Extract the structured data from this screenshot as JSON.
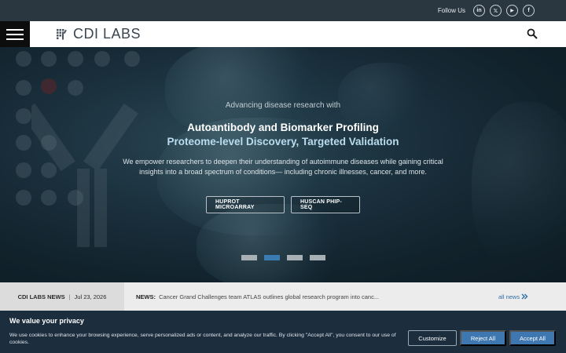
{
  "topbar": {
    "follow_label": "Follow Us",
    "socials": [
      {
        "icon": "linkedin-icon",
        "glyph": "in"
      },
      {
        "icon": "x-icon",
        "glyph": "𝕏"
      },
      {
        "icon": "youtube-icon",
        "glyph": "▶"
      },
      {
        "icon": "facebook-icon",
        "glyph": "f"
      }
    ]
  },
  "header": {
    "logo_text": "CDI LABS",
    "menu_icon": "hamburger-menu-icon",
    "search_icon": "search-icon"
  },
  "hero": {
    "kicker": "Advancing disease research with",
    "headline": "Autoantibody and Biomarker Profiling",
    "subhead": "Proteome-level Discovery, Targeted Validation",
    "description": "We empower researchers to deepen their understanding of autoimmune diseases while gaining critical insights into a broad spectrum of conditions— including chronic illnesses, cancer, and more.",
    "buttons": [
      "HUPROT MICROARRAY",
      "HUSCAN PHIP-SEQ"
    ],
    "slides_total": 4,
    "active_slide": 2
  },
  "news": {
    "label": "CDI LABS NEWS",
    "separator": "|",
    "date": "Jul 23, 2026",
    "prefix": "NEWS:",
    "headline": "Cancer Grand Challenges team ATLAS outlines global research program into canc...",
    "all_news": "all news",
    "all_news_icon": "double-chevron-right-icon"
  },
  "cookie": {
    "title": "We value your privacy",
    "text": "We use cookies to enhance your browsing experience, serve personalized ads or content, and analyze our traffic. By clicking \"Accept All\", you consent to our use of cookies.",
    "customize": "Customize",
    "reject": "Reject All",
    "accept": "Accept All"
  },
  "colors": {
    "accent": "#3f78b0",
    "active_pager": "#3a7bb2",
    "subhead": "#b9dcef"
  }
}
